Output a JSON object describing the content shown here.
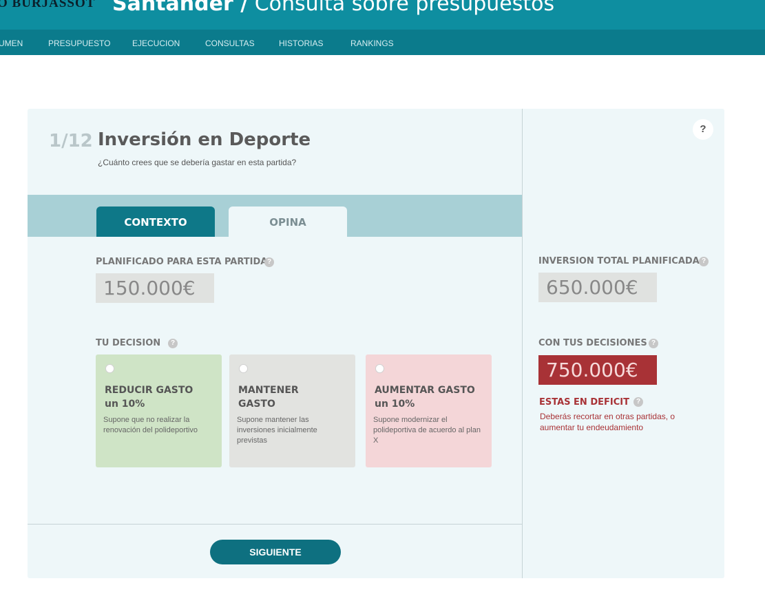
{
  "header": {
    "logo_text": "O BURJASSOT",
    "title_bold": "Santander /",
    "title_light": "Consulta sobre presupuestos"
  },
  "nav": {
    "items": [
      {
        "label": "UMEN"
      },
      {
        "label": "PRESUPUESTO"
      },
      {
        "label": "EJECUCION"
      },
      {
        "label": "CONSULTAS"
      },
      {
        "label": "HISTORIAS"
      },
      {
        "label": "RANKINGS"
      }
    ]
  },
  "question": {
    "step": "1/12",
    "title": "Inversión en Deporte",
    "subtitle": "¿Cuánto crees que se debería gastar en esta partida?"
  },
  "help_button": "?",
  "tabs": [
    {
      "label": "CONTEXTO"
    },
    {
      "label": "OPINA"
    }
  ],
  "planned": {
    "label": "PLANIFICADO PARA ESTA PARTIDA",
    "value": "150.000€",
    "help": "?"
  },
  "decision": {
    "label": "TU DECISION",
    "help": "?",
    "options": [
      {
        "title_line1": "REDUCIR GASTO",
        "title_line2": "un 10%",
        "description": "Supone que no realizar la renovación del polideportivo"
      },
      {
        "title_line1": "MANTENER",
        "title_line2": "GASTO",
        "description": "Supone mantener las inversiones inicialmente previstas"
      },
      {
        "title_line1": "AUMENTAR GASTO",
        "title_line2": "un 10%",
        "description": "Supone modernizar el polideportiva de acuerdo al plan X"
      }
    ]
  },
  "total": {
    "label": "INVERSION TOTAL PLANIFICADA",
    "value": "650.000€",
    "help": "?"
  },
  "with_decisions": {
    "label": "CON TUS DECISIONES",
    "value": "750.000€",
    "help": "?"
  },
  "deficit": {
    "title": "ESTAS EN DEFICIT",
    "help": "?",
    "text": "Deberás recortar en otras partidas, o aumentar tu endeudamiento"
  },
  "actions": {
    "next_label": "SIGUIENTE"
  },
  "colors": {
    "header_bg": "#0e8ea0",
    "nav_bg": "#0b7b8c",
    "accent": "#0e7888",
    "deficit_red": "#a83236",
    "option_green": "#cfe4c6",
    "option_grey": "#e2e3e0",
    "option_pink": "#f4d6d8"
  }
}
